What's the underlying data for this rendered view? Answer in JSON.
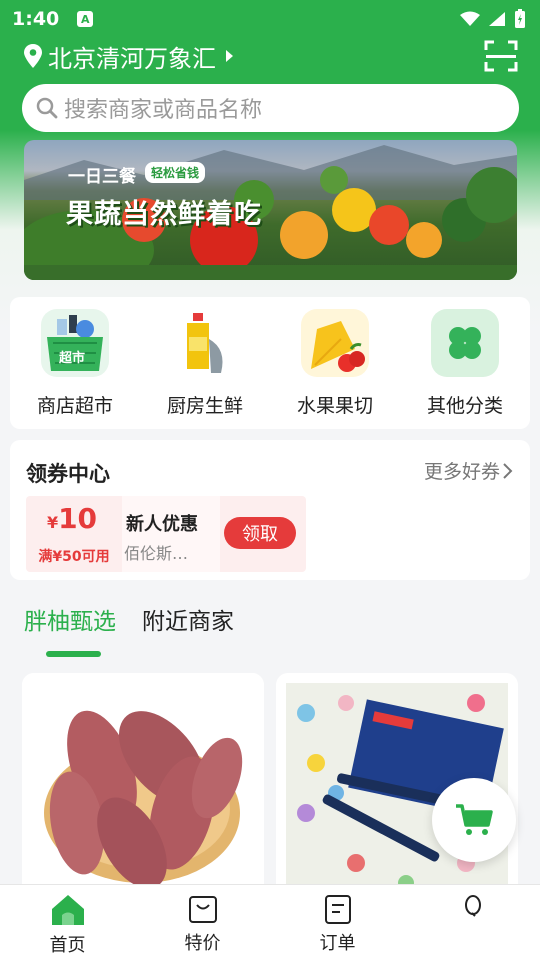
{
  "status": {
    "time": "1:40",
    "app_badge": "A"
  },
  "header": {
    "location": "北京清河万象汇"
  },
  "search": {
    "placeholder": "搜索商家或商品名称"
  },
  "banner": {
    "subtitle": "一日三餐",
    "tag": "轻松省钱",
    "title": "果蔬当然鲜着吃"
  },
  "categories": [
    {
      "label": "商店超市",
      "icon": "supermarket-basket-icon",
      "badge": "超市"
    },
    {
      "label": "厨房生鲜",
      "icon": "oil-fish-icon"
    },
    {
      "label": "水果果切",
      "icon": "fruit-icon"
    },
    {
      "label": "其他分类",
      "icon": "clover-grid-icon"
    }
  ],
  "coupons": {
    "title": "领券中心",
    "more": "更多好券",
    "items": [
      {
        "currency": "¥",
        "amount": "10",
        "condition": "满¥50可用",
        "name": "新人优惠",
        "shop": "佰伦斯…",
        "button": "领取"
      }
    ]
  },
  "tabs": [
    {
      "label": "胖柚甄选",
      "active": true
    },
    {
      "label": "附近商家",
      "active": false
    }
  ],
  "products": [
    {
      "image": "sweet-potatoes"
    },
    {
      "image": "pens-on-polka-dot-cloth"
    }
  ],
  "nav": [
    {
      "label": "首页",
      "icon": "home-icon",
      "active": true
    },
    {
      "label": "特价",
      "icon": "bag-icon"
    },
    {
      "label": "订单",
      "icon": "order-icon"
    },
    {
      "label": "",
      "icon": "profile-icon"
    }
  ],
  "colors": {
    "brand": "#2bb04c",
    "coupon_red": "#e53b3b"
  }
}
